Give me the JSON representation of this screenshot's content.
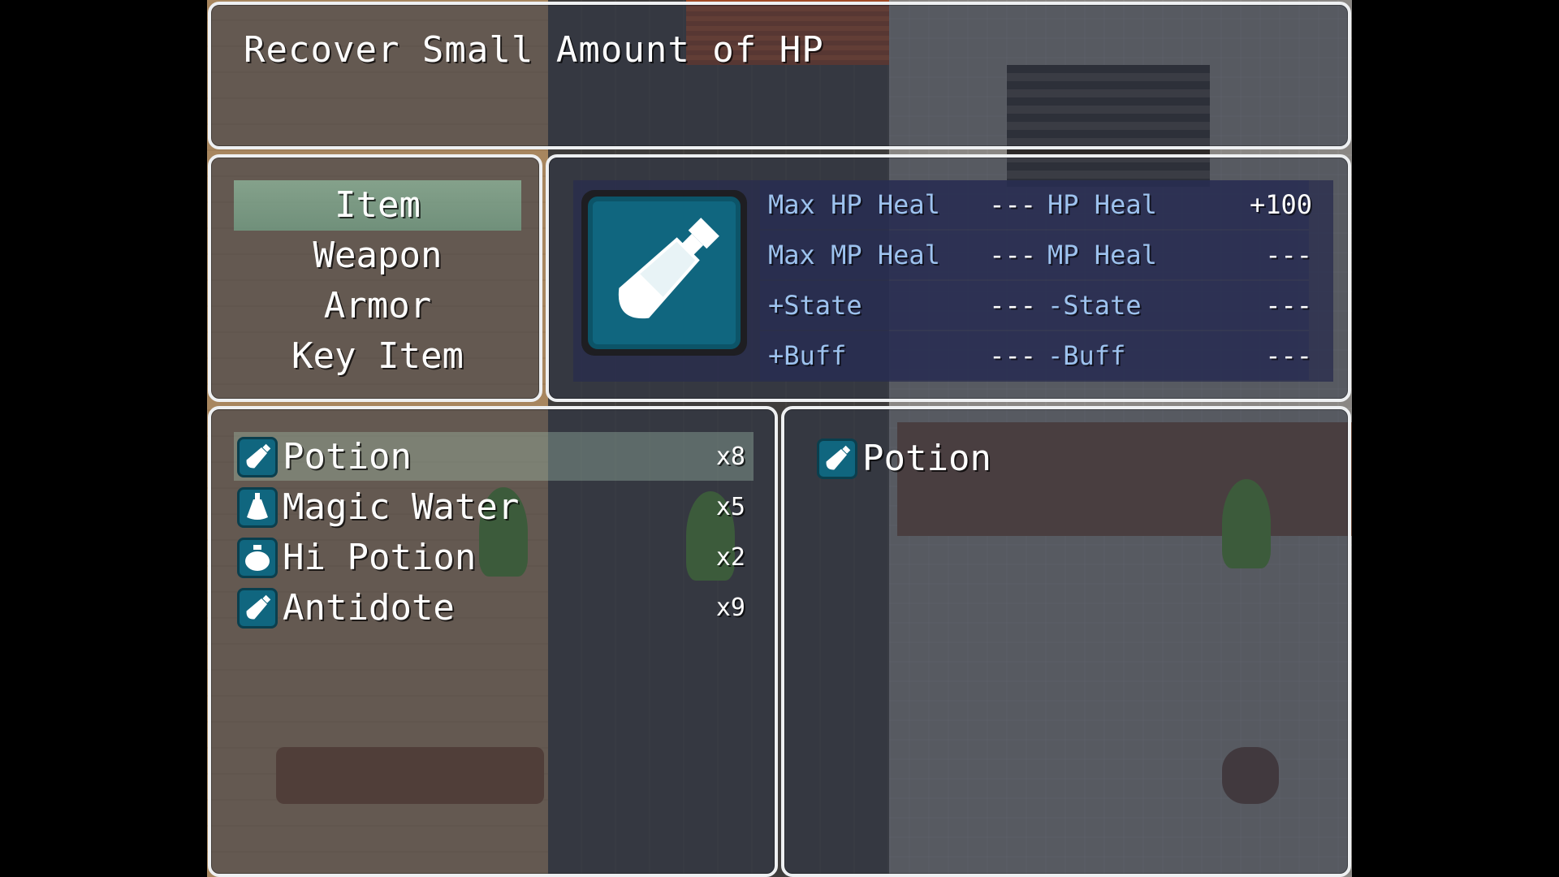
{
  "help": {
    "text": "Recover Small Amount of HP"
  },
  "categories": [
    {
      "label": "Item",
      "selected": true
    },
    {
      "label": "Weapon",
      "selected": false
    },
    {
      "label": "Armor",
      "selected": false
    },
    {
      "label": "Key Item",
      "selected": false
    }
  ],
  "item_info": {
    "icon": "potion-icon",
    "stats": [
      {
        "label": "Max HP Heal",
        "value": "---"
      },
      {
        "label": "HP Heal",
        "value": "+100"
      },
      {
        "label": "Max MP Heal",
        "value": "---"
      },
      {
        "label": "MP Heal",
        "value": "---"
      },
      {
        "label": "+State",
        "value": "---"
      },
      {
        "label": "-State",
        "value": "---"
      },
      {
        "label": "+Buff",
        "value": "---"
      },
      {
        "label": "-Buff",
        "value": "---"
      }
    ]
  },
  "items": [
    {
      "name": "Potion",
      "qty": "x8",
      "icon": "potion-icon",
      "selected": true
    },
    {
      "name": "Magic Water",
      "qty": "x5",
      "icon": "flask-icon",
      "selected": false
    },
    {
      "name": "Hi Potion",
      "qty": "x2",
      "icon": "pot-icon",
      "selected": false
    },
    {
      "name": "Antidote",
      "qty": "x9",
      "icon": "potion-icon",
      "selected": false
    }
  ],
  "detail": {
    "name": "Potion",
    "icon": "potion-icon"
  },
  "colors": {
    "selection": "#8fc8a8",
    "stat_label": "#9dc2ee",
    "icon_bg": "#10667f",
    "window_border": "#eef0f2"
  }
}
